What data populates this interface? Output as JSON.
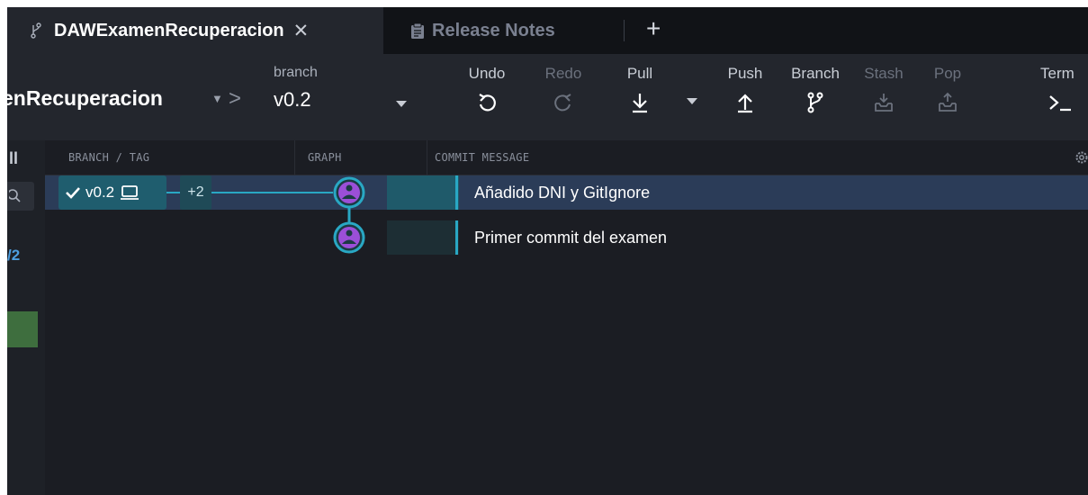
{
  "tabs": {
    "active": {
      "label": "DAWExamenRecuperacion",
      "close": "✕"
    },
    "second": {
      "label": "Release Notes"
    },
    "new_tab": "+"
  },
  "toolbar": {
    "repo": "enRecuperacion",
    "crumb_sep": ">",
    "branch_label": "branch",
    "branch_value": "v0.2",
    "buttons": {
      "undo": "Undo",
      "redo": "Redo",
      "pull": "Pull",
      "push": "Push",
      "branch": "Branch",
      "stash": "Stash",
      "pop": "Pop",
      "terminal": "Term"
    }
  },
  "leftstrip": {
    "bars": "ll",
    "text": "/2"
  },
  "columns": {
    "branch_tag": "BRANCH / TAG",
    "graph": "GRAPH",
    "message": "COMMIT MESSAGE"
  },
  "refs": {
    "tag_name": "v0.2",
    "more": "+2"
  },
  "commits": [
    {
      "message": "Añadido DNI y GitIgnore",
      "selected": true
    },
    {
      "message": "Primer commit del examen",
      "selected": false
    }
  ],
  "colors": {
    "accent": "#29a8c4",
    "avatar": "#9b4fd8",
    "selected_row": "#2b3c58"
  }
}
